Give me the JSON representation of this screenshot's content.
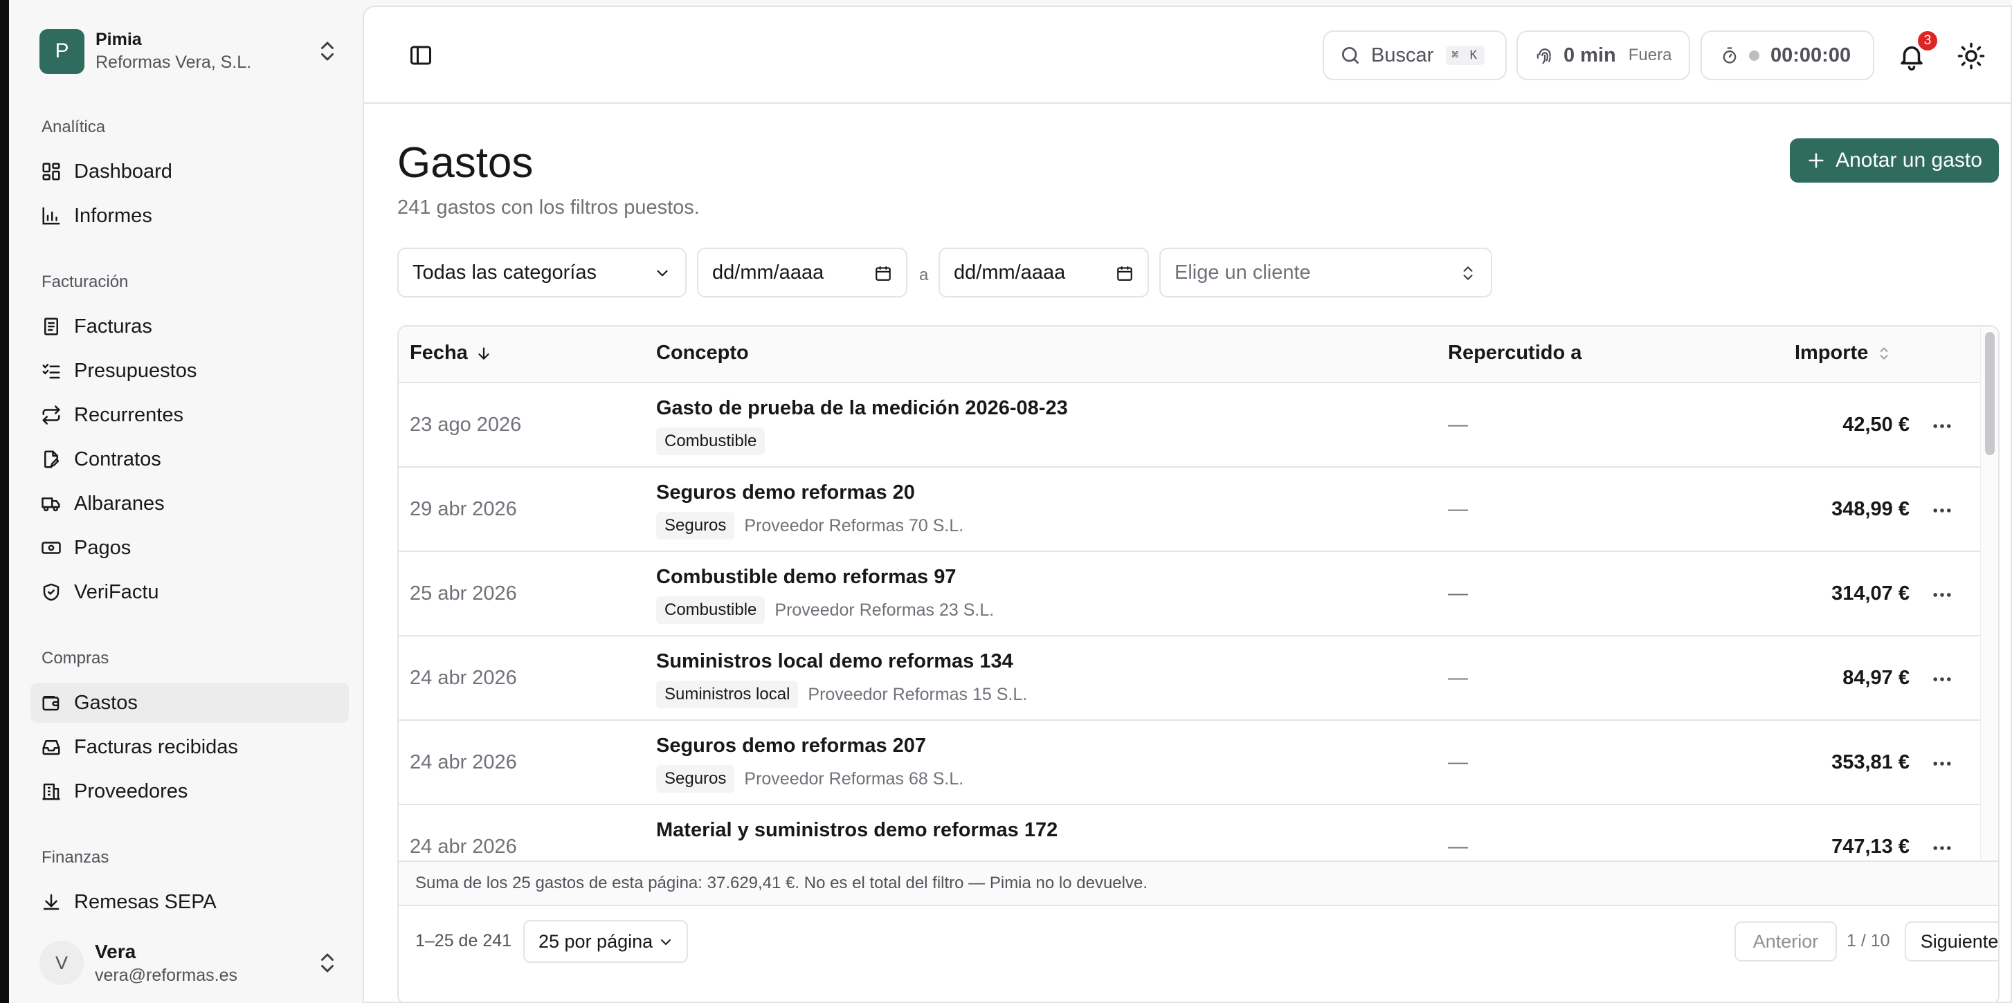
{
  "org": {
    "avatar_letter": "P",
    "name": "Pimia",
    "company": "Reformas Vera, S.L."
  },
  "sidebar": {
    "sections": [
      {
        "label": "Analítica",
        "items": [
          {
            "label": "Dashboard",
            "icon": "dashboard-icon"
          },
          {
            "label": "Informes",
            "icon": "chart-bar-icon"
          }
        ]
      },
      {
        "label": "Facturación",
        "items": [
          {
            "label": "Facturas",
            "icon": "invoice-icon"
          },
          {
            "label": "Presupuestos",
            "icon": "list-check-icon"
          },
          {
            "label": "Recurrentes",
            "icon": "repeat-icon"
          },
          {
            "label": "Contratos",
            "icon": "file-pen-icon"
          },
          {
            "label": "Albaranes",
            "icon": "truck-icon"
          },
          {
            "label": "Pagos",
            "icon": "banknote-icon"
          },
          {
            "label": "VeriFactu",
            "icon": "shield-check-icon"
          }
        ]
      },
      {
        "label": "Compras",
        "items": [
          {
            "label": "Gastos",
            "icon": "wallet-icon",
            "active": true
          },
          {
            "label": "Facturas recibidas",
            "icon": "inbox-icon"
          },
          {
            "label": "Proveedores",
            "icon": "building-icon"
          }
        ]
      },
      {
        "label": "Finanzas",
        "items": [
          {
            "label": "Remesas SEPA",
            "icon": "download-icon"
          }
        ]
      }
    ]
  },
  "user": {
    "avatar_letter": "V",
    "name": "Vera",
    "email": "vera@reformas.es"
  },
  "topbar": {
    "search_label": "Buscar",
    "search_shortcut": "⌘ K",
    "clock_minutes": "0 min",
    "clock_state": "Fuera",
    "timer": "00:00:00",
    "notification_count": "3"
  },
  "page": {
    "title": "Gastos",
    "subtitle": "241 gastos con los filtros puestos.",
    "add_button": "Anotar un gasto"
  },
  "filters": {
    "category": "Todas las categorías",
    "date_from": "dd/mm/aaaa",
    "separator": "a",
    "date_to": "dd/mm/aaaa",
    "client_placeholder": "Elige un cliente"
  },
  "table": {
    "columns": {
      "fecha": "Fecha",
      "concepto": "Concepto",
      "repercutido": "Repercutido a",
      "importe": "Importe"
    },
    "rows": [
      {
        "date": "23 ago 2026",
        "title": "Gasto de prueba de la medición 2026-08-23",
        "tag": "Combustible",
        "supplier": "",
        "rep": "—",
        "amount": "42,50 €"
      },
      {
        "date": "29 abr 2026",
        "title": "Seguros demo reformas 20",
        "tag": "Seguros",
        "supplier": "Proveedor Reformas 70 S.L.",
        "rep": "—",
        "amount": "348,99 €"
      },
      {
        "date": "25 abr 2026",
        "title": "Combustible demo reformas 97",
        "tag": "Combustible",
        "supplier": "Proveedor Reformas 23 S.L.",
        "rep": "—",
        "amount": "314,07 €"
      },
      {
        "date": "24 abr 2026",
        "title": "Suministros local demo reformas 134",
        "tag": "Suministros local",
        "supplier": "Proveedor Reformas 15 S.L.",
        "rep": "—",
        "amount": "84,97 €"
      },
      {
        "date": "24 abr 2026",
        "title": "Seguros demo reformas 207",
        "tag": "Seguros",
        "supplier": "Proveedor Reformas 68 S.L.",
        "rep": "—",
        "amount": "353,81 €"
      },
      {
        "date": "24 abr 2026",
        "title": "Material y suministros demo reformas 172",
        "tag": "",
        "supplier": "",
        "rep": "—",
        "amount": "747,13 €"
      }
    ],
    "sum_note": "Suma de los 25 gastos de esta página: 37.629,41 €. No es el total del filtro — Pimia no lo devuelve."
  },
  "pagination": {
    "range": "1–25 de 241",
    "page_size": "25 por página",
    "prev": "Anterior",
    "page": "1 / 10",
    "next": "Siguiente"
  },
  "colors": {
    "accent": "#2f6b5e",
    "badge": "#dc2626"
  }
}
